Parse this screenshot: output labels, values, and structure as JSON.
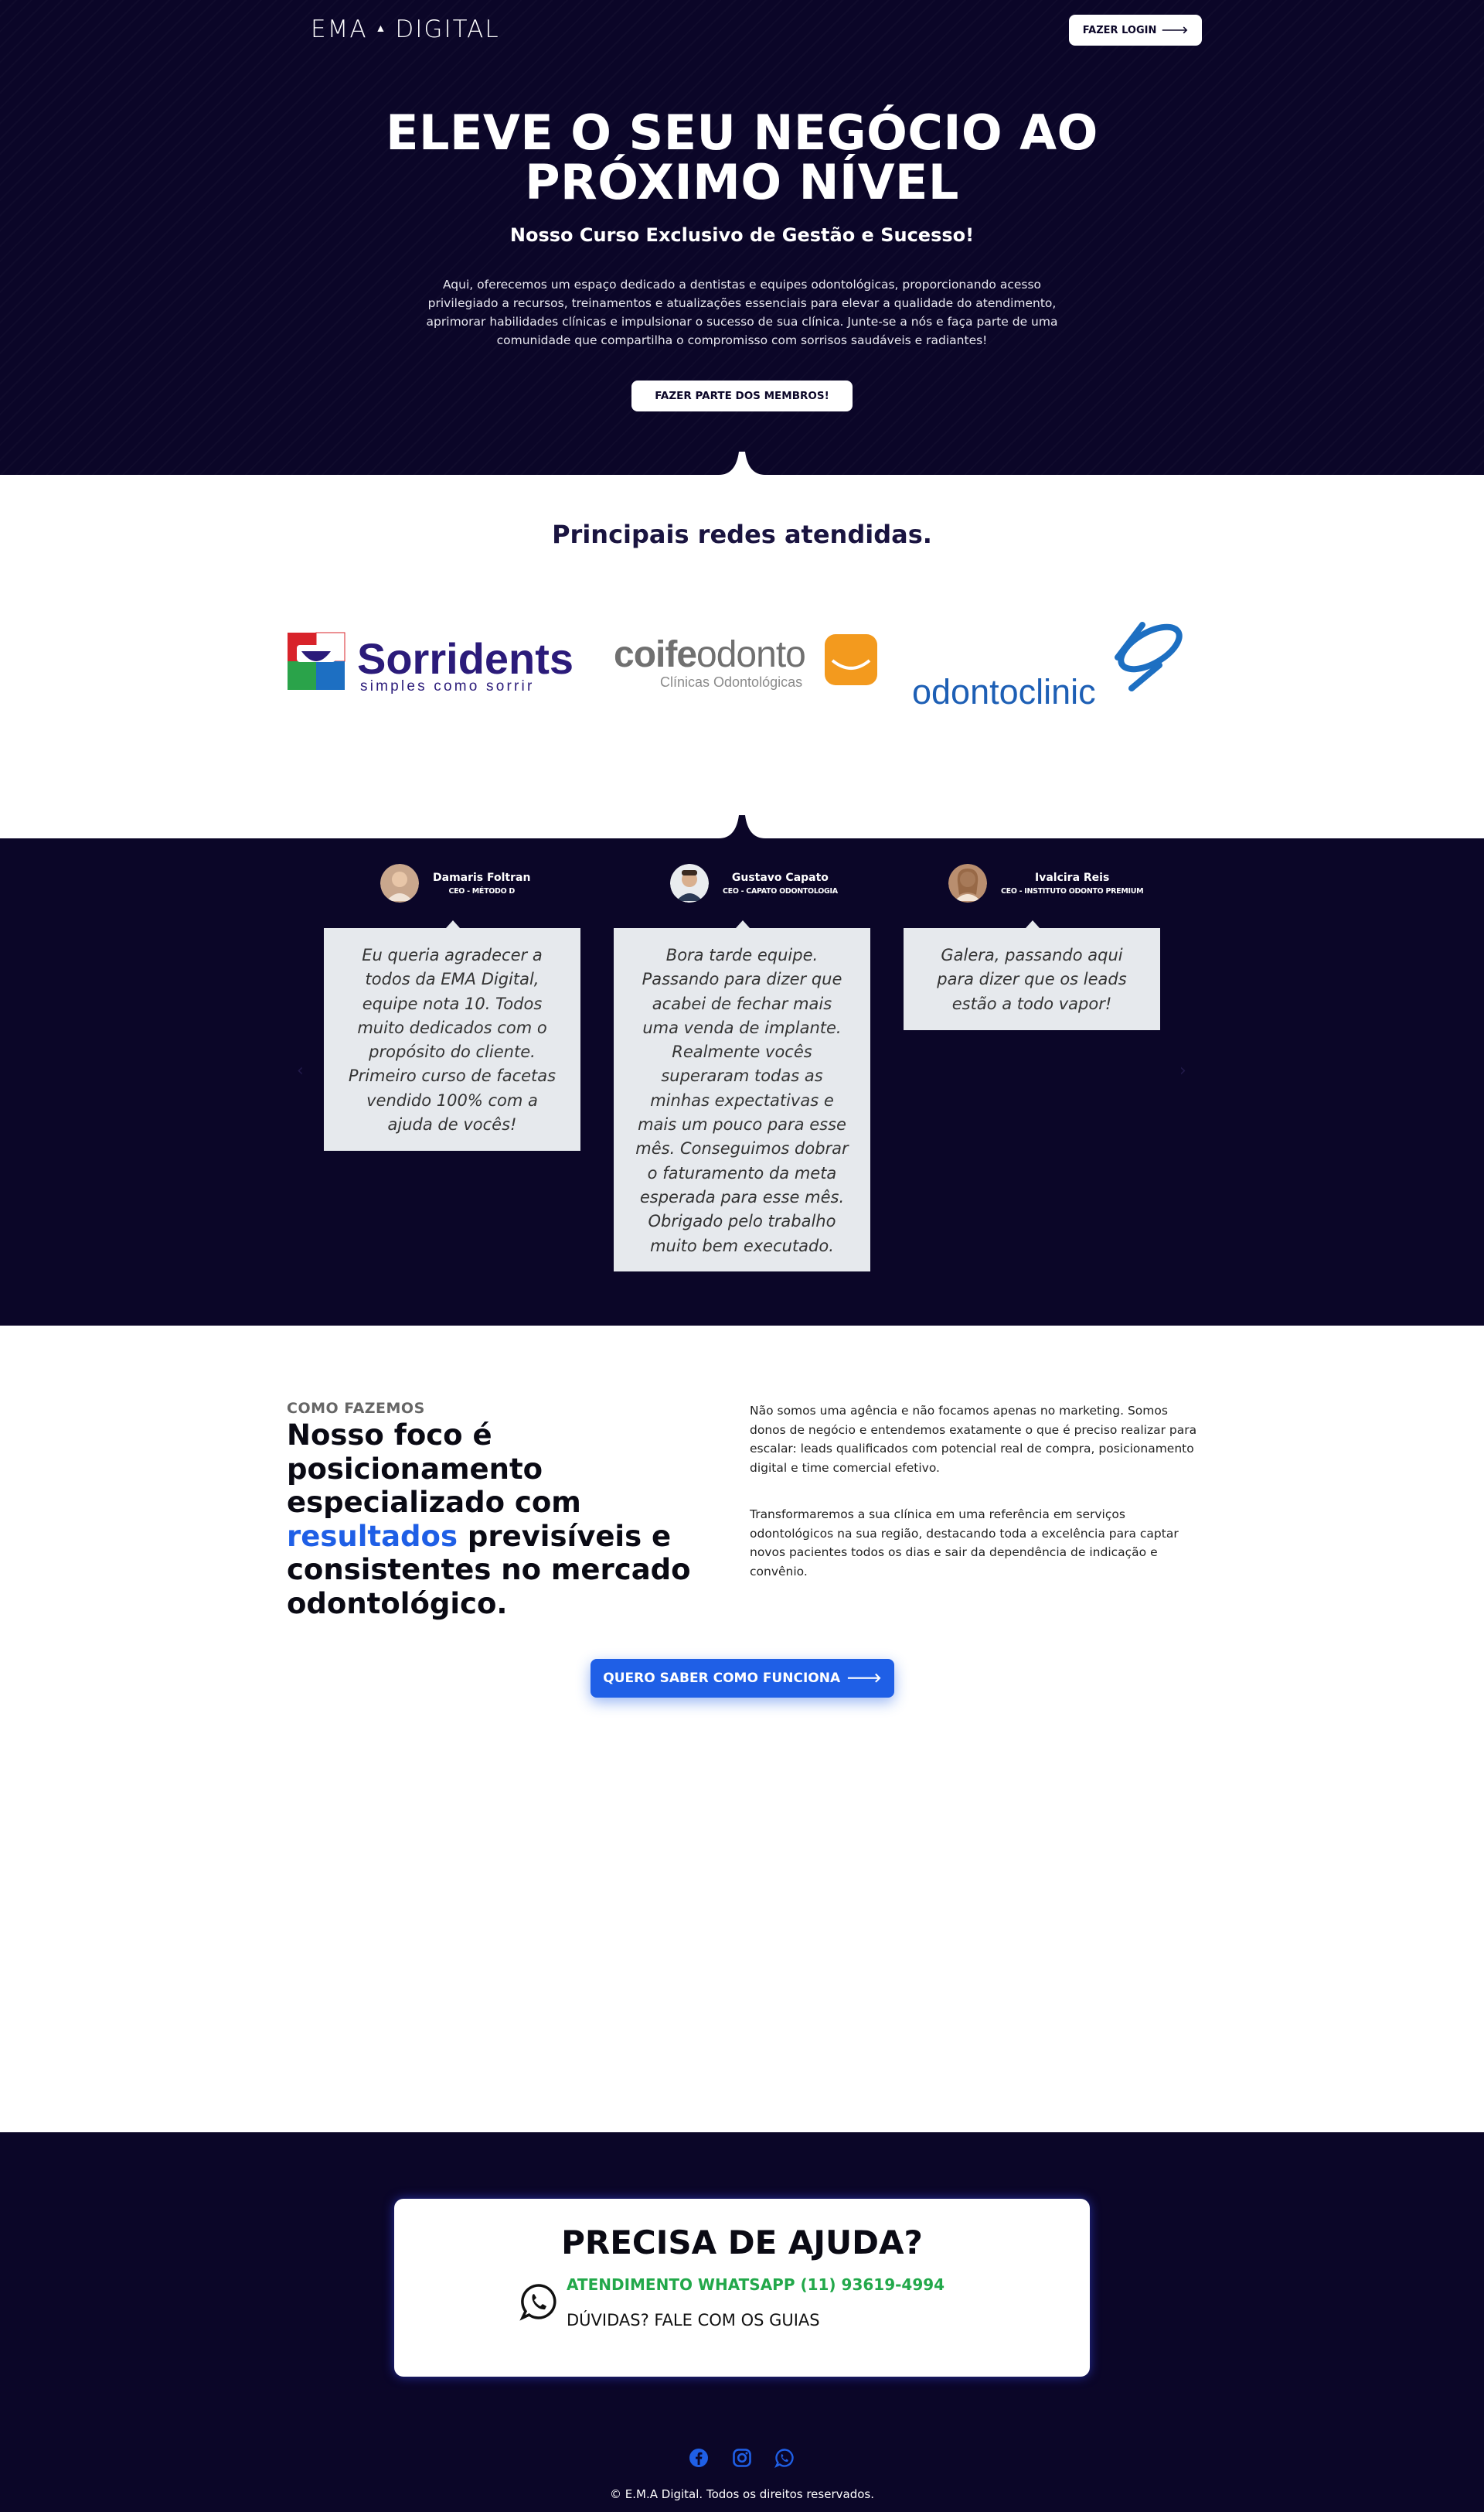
{
  "brand": {
    "logo_left": "EMA",
    "logo_right": "DIGITAL"
  },
  "header": {
    "login_label": "FAZER LOGIN",
    "login_arrow": "🡒"
  },
  "hero": {
    "title": "ELEVE O SEU NEGÓCIO AO PRÓXIMO NÍVEL",
    "subtitle": "Nosso Curso Exclusivo de Gestão e Sucesso!",
    "paragraph": "Aqui, oferecemos um espaço dedicado a dentistas e equipes odontológicas, proporcionando acesso privilegiado a recursos, treinamentos e atualizações essenciais para elevar a qualidade do atendimento, aprimorar habilidades clínicas e impulsionar o sucesso de sua clínica. Junte-se a nós e faça parte de uma comunidade que compartilha o compromisso com sorrisos saudáveis e radiantes!",
    "cta_label": "FAZER PARTE DOS MEMBROS!"
  },
  "networks": {
    "title": "Principais redes atendidas.",
    "logos": [
      {
        "name": "Sorridents",
        "tagline": "simples como sorrir"
      },
      {
        "name_a": "coife",
        "name_b": "odonto",
        "tagline": "Clínicas Odontológicas"
      },
      {
        "name": "odontoclinic"
      }
    ]
  },
  "testimonials": [
    {
      "name": "Damaris Foltran",
      "role": "CEO - MÉTODO D",
      "text": "Eu queria agradecer a todos da EMA Digital, equipe nota 10. Todos muito dedicados com o propósito do cliente. Primeiro curso de facetas vendido 100% com a ajuda de vocês!"
    },
    {
      "name": "Gustavo Capato",
      "role": "CEO - CAPATO ODONTOLOGIA",
      "text": "Bora tarde equipe. Passando para dizer que acabei de fechar mais uma venda de implante. Realmente vocês superaram todas as minhas expectativas e mais um pouco para esse mês. Conseguimos dobrar o faturamento da meta esperada para esse mês. Obrigado pelo trabalho muito bem executado."
    },
    {
      "name": "Ivalcira Reis",
      "role": "CEO - INSTITUTO ODONTO PREMIUM",
      "text": "Galera, passando aqui para dizer que os leads estão a todo vapor!"
    }
  ],
  "carousel": {
    "prev": "‹",
    "next": "›"
  },
  "how": {
    "eyebrow": "COMO FAZEMOS",
    "headline_a": "Nosso foco é posicionamento especializado com ",
    "headline_highlight": "resultados",
    "headline_b": " previsíveis e consistentes no mercado odontológico.",
    "paragraph_1": "Não somos uma agência e não focamos apenas no marketing. Somos donos de negócio e entendemos exatamente o que é preciso realizar para escalar: leads qualificados com potencial real de compra, posicionamento digital e time comercial efetivo.",
    "paragraph_2": "Transformaremos a sua clínica em uma referência em serviços odontológicos na sua região, destacando toda a excelência para captar novos pacientes todos os dias e sair da dependência de indicação e convênio.",
    "cta_label": "QUERO SABER COMO FUNCIONA",
    "cta_arrow": "🡒"
  },
  "help": {
    "title": "PRECISA DE AJUDA?",
    "whatsapp": "ATENDIMENTO WHATSAPP (11) 93619-4994",
    "guides": "DÚVIDAS? FALE COM OS GUIAS"
  },
  "footer": {
    "social_icons": [
      "facebook-icon",
      "instagram-icon",
      "whatsapp-icon"
    ],
    "copyright": "© E.M.A Digital. Todos os direitos reservados."
  },
  "colors": {
    "navy": "#0b0628",
    "accent_blue": "#1f5fe6",
    "whatsapp_green": "#22a84a"
  }
}
